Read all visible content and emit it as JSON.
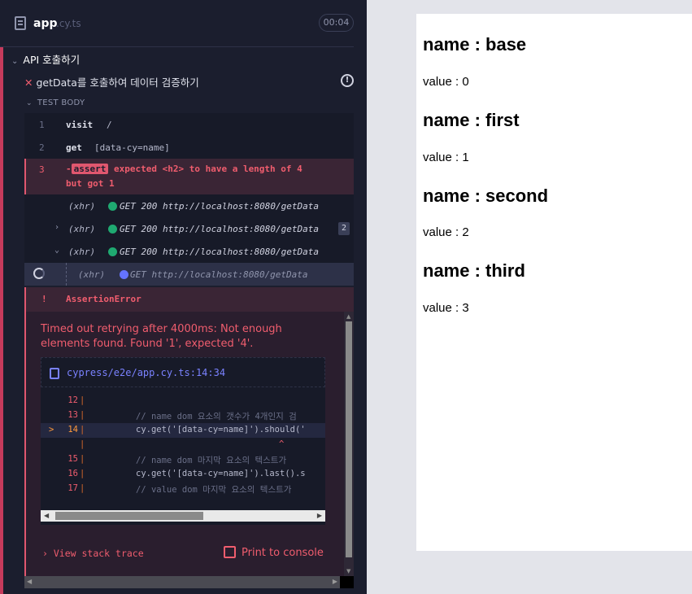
{
  "header": {
    "spec_name": "app",
    "spec_ext": ".cy.ts",
    "duration": "00:04"
  },
  "suite": {
    "title": "API 호출하기"
  },
  "test": {
    "title": "getData를 호출하여 데이터 검증하기",
    "section": "TEST BODY"
  },
  "commands": [
    {
      "num": "1",
      "name": "visit",
      "arg": "/"
    },
    {
      "num": "2",
      "name": "get",
      "arg": "[data-cy=name]"
    },
    {
      "num": "3",
      "prefix": "-",
      "name": "assert",
      "message": "expected <h2> to have a length of 4",
      "message2": "but got 1"
    }
  ],
  "xhr_rows": [
    {
      "label": "(xhr)",
      "text": "GET 200 http://localhost:8080/getData",
      "expander": "",
      "count": ""
    },
    {
      "label": "(xhr)",
      "text": "GET 200 http://localhost:8080/getData",
      "expander": "›",
      "count": "2"
    },
    {
      "label": "(xhr)",
      "text": "GET 200 http://localhost:8080/getData",
      "expander": "⌄",
      "count": ""
    },
    {
      "label": "(xhr)",
      "text": "GET http://localhost:8080/getData",
      "expander": "",
      "count": ""
    }
  ],
  "error": {
    "bang": "!",
    "title": "AssertionError",
    "message": "Timed out retrying after 4000ms: Not enough elements found. Found '1', expected '4'.",
    "file": "cypress/e2e/app.cy.ts:14:34",
    "code": [
      {
        "ln": "12",
        "src": ""
      },
      {
        "ln": "13",
        "src": "// name dom 요소의 갯수가 4개인지 검"
      },
      {
        "ln": "14",
        "src": "cy.get('[data-cy=name]').should('"
      },
      {
        "ln": "",
        "src": ""
      },
      {
        "ln": "15",
        "src": "// name dom 마지막 요소의 텍스트가"
      },
      {
        "ln": "16",
        "src": "cy.get('[data-cy=name]').last().s"
      },
      {
        "ln": "17",
        "src": "// value dom 마지막 요소의 텍스트가"
      }
    ],
    "stack_label": "View stack trace",
    "print_label": "Print to console"
  },
  "app": {
    "items": [
      {
        "name": "name : base",
        "value": "value : 0"
      },
      {
        "name": "name : first",
        "value": "value : 1"
      },
      {
        "name": "name : second",
        "value": "value : 2"
      },
      {
        "name": "name : third",
        "value": "value : 3"
      }
    ]
  },
  "colors": {
    "fail": "#f05d6e",
    "pass": "#1fa971",
    "pending": "#6473ff",
    "bg": "#1b1e2e"
  }
}
